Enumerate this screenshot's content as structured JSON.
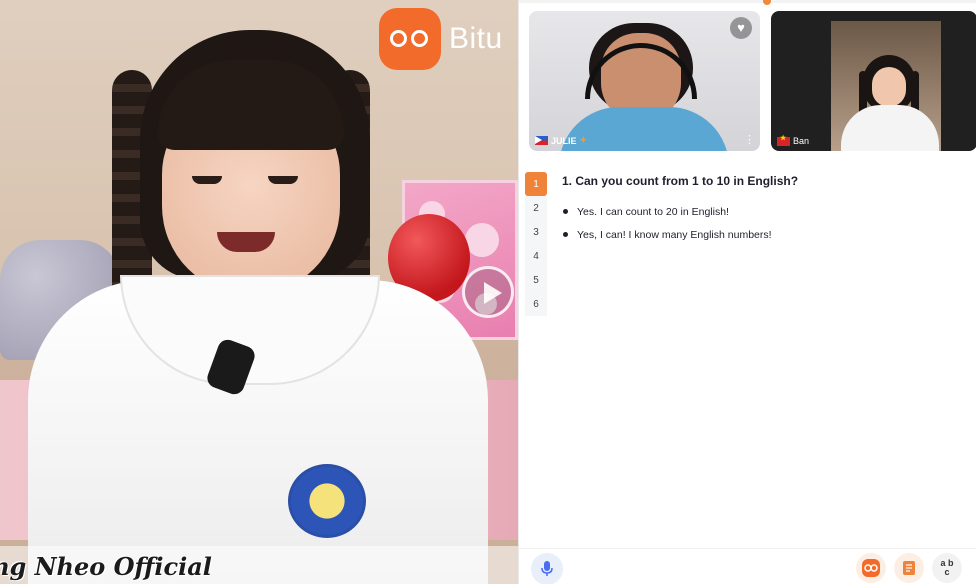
{
  "brand": {
    "name": "Bitu",
    "accent_color": "#f26b2a"
  },
  "video": {
    "watermark": "ng Nheo Official",
    "play_icon": "play-icon"
  },
  "participants": [
    {
      "name": "JULIE",
      "flag": "philippines-flag-icon",
      "badge": "star-badge-icon"
    },
    {
      "name": "Ban",
      "flag": "vietnam-flag-icon"
    }
  ],
  "quiz": {
    "question_numbers": [
      "1",
      "2",
      "3",
      "4",
      "5",
      "6"
    ],
    "active_question": "1",
    "question": "1. Can you count from 1 to 10 in English?",
    "answers": [
      "Yes. I can count to 20 in English!",
      "Yes, I can! I know many English numbers!"
    ]
  },
  "toolbar": {
    "mic_icon": "microphone-icon",
    "buttons": [
      "bitu-logo-icon",
      "notes-icon",
      "vocabulary-abc-icon"
    ],
    "vocab_label": "a b c"
  }
}
